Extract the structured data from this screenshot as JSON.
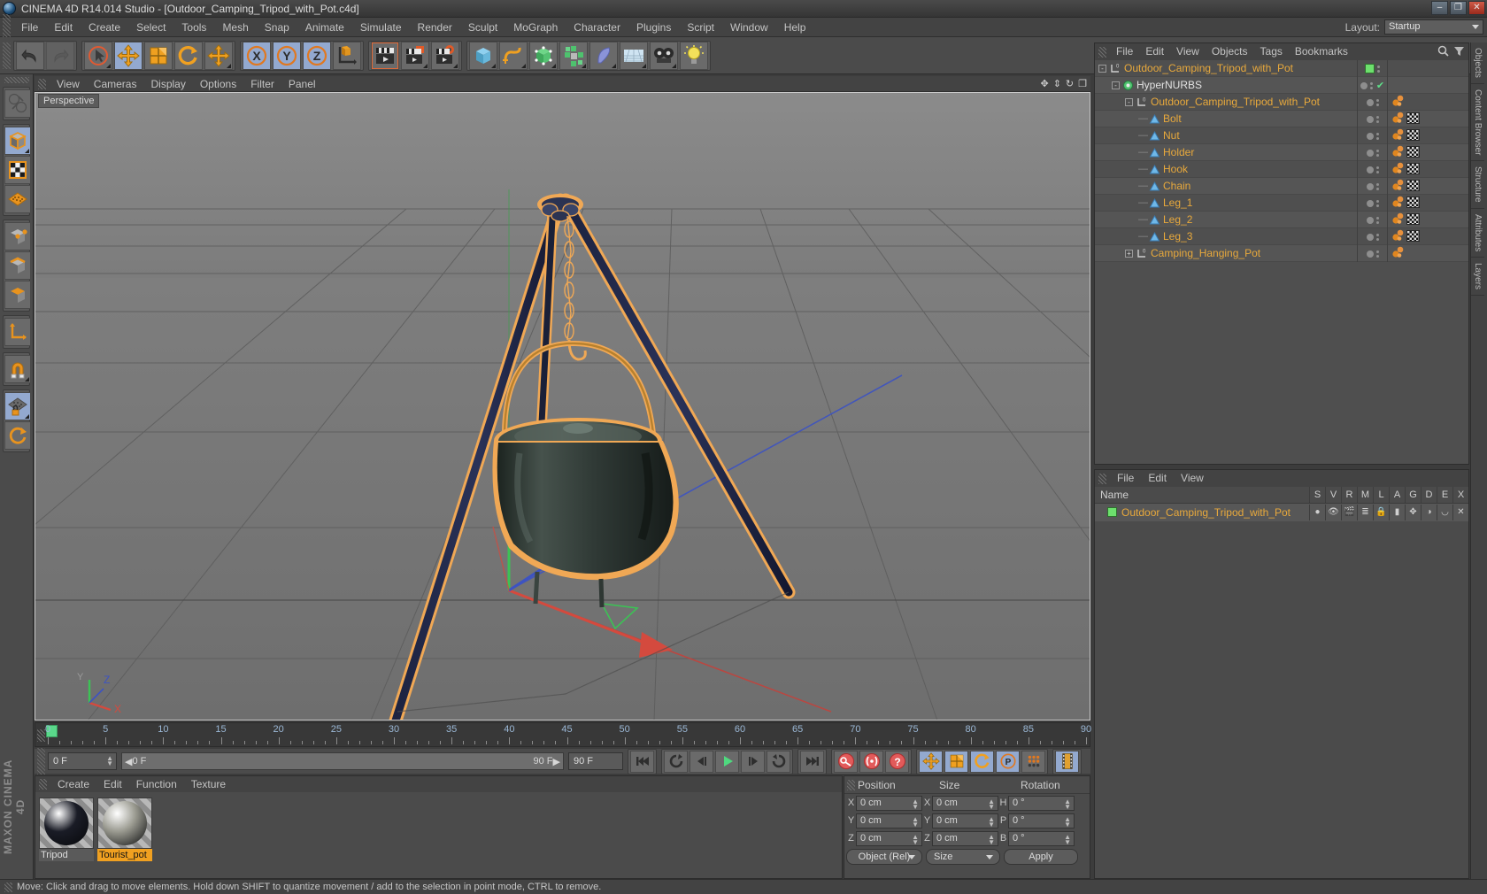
{
  "window": {
    "title": "CINEMA 4D R14.014 Studio - [Outdoor_Camping_Tripod_with_Pot.c4d]",
    "minimize": "–",
    "maximize": "❐",
    "close": "✕"
  },
  "menubar": {
    "items": [
      "File",
      "Edit",
      "Create",
      "Select",
      "Tools",
      "Mesh",
      "Snap",
      "Animate",
      "Simulate",
      "Render",
      "Sculpt",
      "MoGraph",
      "Character",
      "Plugins",
      "Script",
      "Window",
      "Help"
    ],
    "layout_label": "Layout:",
    "layout_value": "Startup"
  },
  "viewport": {
    "menu": [
      "View",
      "Cameras",
      "Display",
      "Options",
      "Filter",
      "Panel"
    ],
    "label": "Perspective",
    "axis_x": "X",
    "axis_z": "Z"
  },
  "timeline": {
    "ticks": [
      0,
      5,
      10,
      15,
      20,
      25,
      30,
      35,
      40,
      45,
      50,
      55,
      60,
      65,
      70,
      75,
      80,
      85,
      90
    ],
    "current_frame": "0 F",
    "range_start": "0 F",
    "range_end": "90 F",
    "max_frame": "90 F"
  },
  "playback": {
    "goto_start": "goto-start-icon",
    "rewind": "rewind-icon",
    "step_back": "step-back-icon",
    "play": "play-icon",
    "step_fwd": "step-forward-icon",
    "loop": "loop-icon",
    "goto_end": "goto-end-icon",
    "record": "record-key-icon",
    "autokey": "autokey-icon",
    "keyhelp": "key-question-icon",
    "pos": "record-position-icon",
    "scale": "record-scale-icon",
    "rot": "record-rotation-icon",
    "param": "record-parameter-icon",
    "points": "record-points-icon",
    "filmstrip": "filmstrip-icon"
  },
  "material_manager": {
    "menu": [
      "Create",
      "Edit",
      "Function",
      "Texture"
    ],
    "materials": [
      {
        "name": "Tripod",
        "selected": false,
        "color": "#1a1c26"
      },
      {
        "name": "Tourist_pot",
        "selected": true,
        "color": "#9a9a90"
      }
    ]
  },
  "coordinates": {
    "headers": [
      "Position",
      "Size",
      "Rotation"
    ],
    "rows": [
      {
        "p_axis": "X",
        "p_val": "0 cm",
        "s_axis": "X",
        "s_val": "0 cm",
        "r_axis": "H",
        "r_val": "0 °"
      },
      {
        "p_axis": "Y",
        "p_val": "0 cm",
        "s_axis": "Y",
        "s_val": "0 cm",
        "r_axis": "P",
        "r_val": "0 °"
      },
      {
        "p_axis": "Z",
        "p_val": "0 cm",
        "s_axis": "Z",
        "s_val": "0 cm",
        "r_axis": "B",
        "r_val": "0 °"
      }
    ],
    "mode_dropdown": "Object (Rel)",
    "size_dropdown": "Size",
    "apply_button": "Apply"
  },
  "object_manager": {
    "menu": [
      "File",
      "Edit",
      "View",
      "Objects",
      "Tags",
      "Bookmarks"
    ],
    "search_icon": "search-icon",
    "objects": [
      {
        "name": "Outdoor_Camping_Tripod_with_Pot",
        "depth": 0,
        "icon": "null-object-icon",
        "expander": "-",
        "color": "orange",
        "chip": "#6de06d",
        "tags": []
      },
      {
        "name": "HyperNURBS",
        "depth": 1,
        "icon": "hypernurbs-icon",
        "expander": "-",
        "color": "white",
        "check": true,
        "tags": []
      },
      {
        "name": "Outdoor_Camping_Tripod_with_Pot",
        "depth": 2,
        "icon": "null-object-icon",
        "expander": "-",
        "color": "orange",
        "tags": [
          "texture"
        ]
      },
      {
        "name": "Bolt",
        "depth": 3,
        "icon": "polygon-object-icon",
        "expander": "",
        "color": "orange",
        "tags": [
          "texture",
          "checker"
        ]
      },
      {
        "name": "Nut",
        "depth": 3,
        "icon": "polygon-object-icon",
        "expander": "",
        "color": "orange",
        "tags": [
          "texture",
          "checker"
        ]
      },
      {
        "name": "Holder",
        "depth": 3,
        "icon": "polygon-object-icon",
        "expander": "",
        "color": "orange",
        "tags": [
          "texture",
          "checker"
        ]
      },
      {
        "name": "Hook",
        "depth": 3,
        "icon": "polygon-object-icon",
        "expander": "",
        "color": "orange",
        "tags": [
          "texture",
          "checker"
        ]
      },
      {
        "name": "Chain",
        "depth": 3,
        "icon": "polygon-object-icon",
        "expander": "",
        "color": "orange",
        "tags": [
          "texture",
          "checker"
        ]
      },
      {
        "name": "Leg_1",
        "depth": 3,
        "icon": "polygon-object-icon",
        "expander": "",
        "color": "orange",
        "tags": [
          "texture",
          "checker"
        ]
      },
      {
        "name": "Leg_2",
        "depth": 3,
        "icon": "polygon-object-icon",
        "expander": "",
        "color": "orange",
        "tags": [
          "texture",
          "checker"
        ]
      },
      {
        "name": "Leg_3",
        "depth": 3,
        "icon": "polygon-object-icon",
        "expander": "",
        "color": "orange",
        "tags": [
          "texture",
          "checker"
        ]
      },
      {
        "name": "Camping_Hanging_Pot",
        "depth": 2,
        "icon": "null-object-icon",
        "expander": "+",
        "color": "orange",
        "tags": [
          "texture"
        ]
      }
    ]
  },
  "attributes_panel": {
    "menu": [
      "File",
      "Edit",
      "View"
    ],
    "name_header": "Name",
    "columns": [
      "S",
      "V",
      "R",
      "M",
      "L",
      "A",
      "G",
      "D",
      "E",
      "X"
    ],
    "rows": [
      {
        "name": "Outdoor_Camping_Tripod_with_Pot",
        "chip": "#6de06d"
      }
    ]
  },
  "right_dock": {
    "tabs": [
      "Objects",
      "Content Browser",
      "Structure",
      "Attributes",
      "Layers"
    ]
  },
  "status_bar": {
    "message": "Move: Click and drag to move elements. Hold down SHIFT to quantize movement / add to the selection in point mode, CTRL to remove."
  },
  "toolbar": {
    "undo": "undo-icon",
    "redo": "redo-icon",
    "select": "live-selection-icon",
    "move": "move-icon",
    "scale": "scale-icon",
    "rotate": "rotate-icon",
    "axis_move": "axis-move-icon",
    "lock_x": "X",
    "lock_y": "Y",
    "lock_z": "Z",
    "world_axis": "world-coordinate-icon",
    "render_view": "render-view-icon",
    "render_region": "render-to-picture-icon",
    "render_settings": "render-settings-icon",
    "primitive": "cube-primitive-icon",
    "spline": "spline-icon",
    "nurbs": "nurbs-icon",
    "array": "array-icon",
    "deformer": "bend-deformer-icon",
    "scene": "floor-icon",
    "camera": "camera-icon",
    "light": "light-icon"
  },
  "left_toolbar": {
    "buttons": [
      "undo-axis-icon",
      "model-mode-icon",
      "texture-mode-icon",
      "points-mode-icon",
      "edges-mode-icon",
      "polygons-mode-icon",
      "axis-mode-icon",
      "world-object-axis-icon",
      "enable-snap-icon",
      "workplane-lock-icon",
      "workplane-icon"
    ]
  },
  "colors": {
    "accent_orange": "#e8a93c",
    "highlight_blue": "#93a9cf",
    "panel_bg": "#4b4b4b",
    "viewport_bg": "#7a7a7a"
  }
}
